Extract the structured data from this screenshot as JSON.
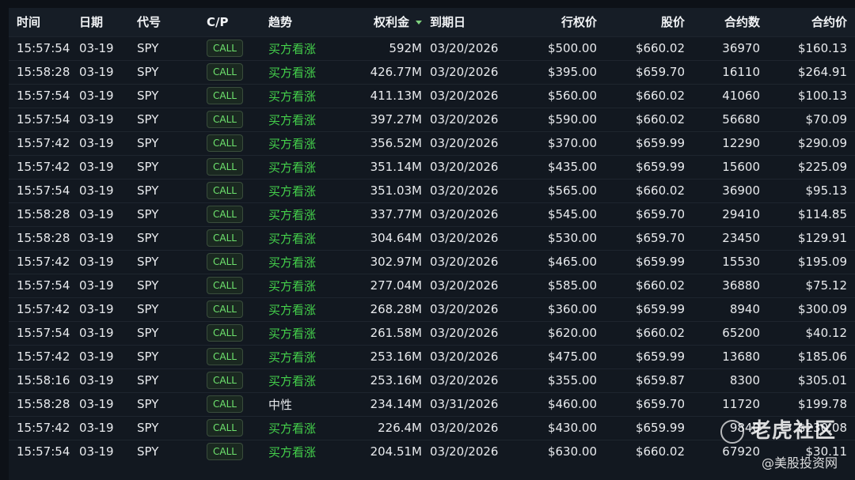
{
  "columns": [
    {
      "key": "time",
      "label": "时间"
    },
    {
      "key": "date",
      "label": "日期"
    },
    {
      "key": "symbol",
      "label": "代号"
    },
    {
      "key": "cp",
      "label": "C/P"
    },
    {
      "key": "trend",
      "label": "趋势"
    },
    {
      "key": "premium",
      "label": "权利金"
    },
    {
      "key": "expiry",
      "label": "到期日"
    },
    {
      "key": "strike",
      "label": "行权价"
    },
    {
      "key": "stock_price",
      "label": "股价"
    },
    {
      "key": "contracts",
      "label": "合约数"
    },
    {
      "key": "contract_price",
      "label": "合约价"
    }
  ],
  "sort": {
    "column": "premium",
    "direction": "desc"
  },
  "colors": {
    "bullish": "#44d14b",
    "call_badge": "#6ee36e"
  },
  "rows": [
    {
      "time": "15:57:54",
      "date": "03-19",
      "symbol": "SPY",
      "cp": "CALL",
      "trend": "买方看涨",
      "premium": "592M",
      "expiry": "03/20/2026",
      "strike": "$500.00",
      "stock_price": "$660.02",
      "contracts": "36970",
      "contract_price": "$160.13"
    },
    {
      "time": "15:58:28",
      "date": "03-19",
      "symbol": "SPY",
      "cp": "CALL",
      "trend": "买方看涨",
      "premium": "426.77M",
      "expiry": "03/20/2026",
      "strike": "$395.00",
      "stock_price": "$659.70",
      "contracts": "16110",
      "contract_price": "$264.91"
    },
    {
      "time": "15:57:54",
      "date": "03-19",
      "symbol": "SPY",
      "cp": "CALL",
      "trend": "买方看涨",
      "premium": "411.13M",
      "expiry": "03/20/2026",
      "strike": "$560.00",
      "stock_price": "$660.02",
      "contracts": "41060",
      "contract_price": "$100.13"
    },
    {
      "time": "15:57:54",
      "date": "03-19",
      "symbol": "SPY",
      "cp": "CALL",
      "trend": "买方看涨",
      "premium": "397.27M",
      "expiry": "03/20/2026",
      "strike": "$590.00",
      "stock_price": "$660.02",
      "contracts": "56680",
      "contract_price": "$70.09"
    },
    {
      "time": "15:57:42",
      "date": "03-19",
      "symbol": "SPY",
      "cp": "CALL",
      "trend": "买方看涨",
      "premium": "356.52M",
      "expiry": "03/20/2026",
      "strike": "$370.00",
      "stock_price": "$659.99",
      "contracts": "12290",
      "contract_price": "$290.09"
    },
    {
      "time": "15:57:42",
      "date": "03-19",
      "symbol": "SPY",
      "cp": "CALL",
      "trend": "买方看涨",
      "premium": "351.14M",
      "expiry": "03/20/2026",
      "strike": "$435.00",
      "stock_price": "$659.99",
      "contracts": "15600",
      "contract_price": "$225.09"
    },
    {
      "time": "15:57:54",
      "date": "03-19",
      "symbol": "SPY",
      "cp": "CALL",
      "trend": "买方看涨",
      "premium": "351.03M",
      "expiry": "03/20/2026",
      "strike": "$565.00",
      "stock_price": "$660.02",
      "contracts": "36900",
      "contract_price": "$95.13"
    },
    {
      "time": "15:58:28",
      "date": "03-19",
      "symbol": "SPY",
      "cp": "CALL",
      "trend": "买方看涨",
      "premium": "337.77M",
      "expiry": "03/20/2026",
      "strike": "$545.00",
      "stock_price": "$659.70",
      "contracts": "29410",
      "contract_price": "$114.85"
    },
    {
      "time": "15:58:28",
      "date": "03-19",
      "symbol": "SPY",
      "cp": "CALL",
      "trend": "买方看涨",
      "premium": "304.64M",
      "expiry": "03/20/2026",
      "strike": "$530.00",
      "stock_price": "$659.70",
      "contracts": "23450",
      "contract_price": "$129.91"
    },
    {
      "time": "15:57:42",
      "date": "03-19",
      "symbol": "SPY",
      "cp": "CALL",
      "trend": "买方看涨",
      "premium": "302.97M",
      "expiry": "03/20/2026",
      "strike": "$465.00",
      "stock_price": "$659.99",
      "contracts": "15530",
      "contract_price": "$195.09"
    },
    {
      "time": "15:57:54",
      "date": "03-19",
      "symbol": "SPY",
      "cp": "CALL",
      "trend": "买方看涨",
      "premium": "277.04M",
      "expiry": "03/20/2026",
      "strike": "$585.00",
      "stock_price": "$660.02",
      "contracts": "36880",
      "contract_price": "$75.12"
    },
    {
      "time": "15:57:42",
      "date": "03-19",
      "symbol": "SPY",
      "cp": "CALL",
      "trend": "买方看涨",
      "premium": "268.28M",
      "expiry": "03/20/2026",
      "strike": "$360.00",
      "stock_price": "$659.99",
      "contracts": "8940",
      "contract_price": "$300.09"
    },
    {
      "time": "15:57:54",
      "date": "03-19",
      "symbol": "SPY",
      "cp": "CALL",
      "trend": "买方看涨",
      "premium": "261.58M",
      "expiry": "03/20/2026",
      "strike": "$620.00",
      "stock_price": "$660.02",
      "contracts": "65200",
      "contract_price": "$40.12"
    },
    {
      "time": "15:57:42",
      "date": "03-19",
      "symbol": "SPY",
      "cp": "CALL",
      "trend": "买方看涨",
      "premium": "253.16M",
      "expiry": "03/20/2026",
      "strike": "$475.00",
      "stock_price": "$659.99",
      "contracts": "13680",
      "contract_price": "$185.06"
    },
    {
      "time": "15:58:16",
      "date": "03-19",
      "symbol": "SPY",
      "cp": "CALL",
      "trend": "买方看涨",
      "premium": "253.16M",
      "expiry": "03/20/2026",
      "strike": "$355.00",
      "stock_price": "$659.87",
      "contracts": "8300",
      "contract_price": "$305.01"
    },
    {
      "time": "15:58:28",
      "date": "03-19",
      "symbol": "SPY",
      "cp": "CALL",
      "trend": "中性",
      "premium": "234.14M",
      "expiry": "03/31/2026",
      "strike": "$460.00",
      "stock_price": "$659.70",
      "contracts": "11720",
      "contract_price": "$199.78"
    },
    {
      "time": "15:57:42",
      "date": "03-19",
      "symbol": "SPY",
      "cp": "CALL",
      "trend": "买方看涨",
      "premium": "226.4M",
      "expiry": "03/20/2026",
      "strike": "$430.00",
      "stock_price": "$659.99",
      "contracts": "9840",
      "contract_price": "$230.08"
    },
    {
      "time": "15:57:54",
      "date": "03-19",
      "symbol": "SPY",
      "cp": "CALL",
      "trend": "买方看涨",
      "premium": "204.51M",
      "expiry": "03/20/2026",
      "strike": "$630.00",
      "stock_price": "$660.02",
      "contracts": "67920",
      "contract_price": "$30.11"
    }
  ],
  "watermark": {
    "logo_text": "老虎社区",
    "sub_text": "@美股投资网",
    "icon": "tiger-icon"
  }
}
